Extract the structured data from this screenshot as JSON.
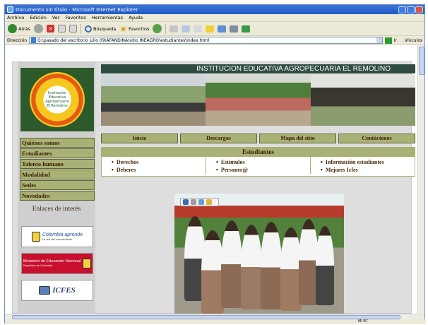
{
  "window": {
    "title": "Documento sin título - Microsoft Internet Explorer"
  },
  "menu": [
    "Archivo",
    "Edición",
    "Ver",
    "Favoritos",
    "Herramientas",
    "Ayuda"
  ],
  "toolbar": {
    "back_label": "Atrás",
    "search_label": "Búsqueda",
    "favorites_label": "Favoritos"
  },
  "address": {
    "label": "Dirección",
    "value": "G:\\pasado del escritorio julio 09\\AFANDINA\\sitio INEAGRO\\estudiantes\\index.html",
    "go_label": "Ir",
    "links_label": "Vínculos"
  },
  "status": {
    "zone": "Mi PC"
  },
  "site": {
    "title": "INSTITUCION EDUCATIVA AGROPECUARIA EL REMOLINO",
    "logo_text": "Institución Educativa Agropecuaria El Remolino",
    "sidebar_nav": [
      "Quiénes somos",
      "Estudiantes",
      "Talento humano",
      "Modalidad",
      "Sedes",
      "Novedades"
    ],
    "enlaces_title": "Enlaces de interés",
    "banners": [
      {
        "name": "Colombia aprende",
        "sub": "La red del conocimiento"
      },
      {
        "name": "Ministerio de Educación Nacional",
        "sub": "República de Colombia"
      },
      {
        "name": "ICFES"
      }
    ],
    "top_nav": [
      "Inicio",
      "Descargas",
      "Mapa del sitio",
      "Contáctenos"
    ],
    "estudiantes": {
      "heading": "Estudiantes",
      "col1": [
        "Derechos",
        "Deberes"
      ],
      "col2": [
        "Estímulos",
        "Personer@"
      ],
      "col3": [
        "Información estudiantes",
        "Mejores Icfes"
      ]
    }
  },
  "colors": {
    "nav_bg": "#aab174",
    "header_bg": "#2f4c41",
    "text_brown": "#3a1b05"
  }
}
